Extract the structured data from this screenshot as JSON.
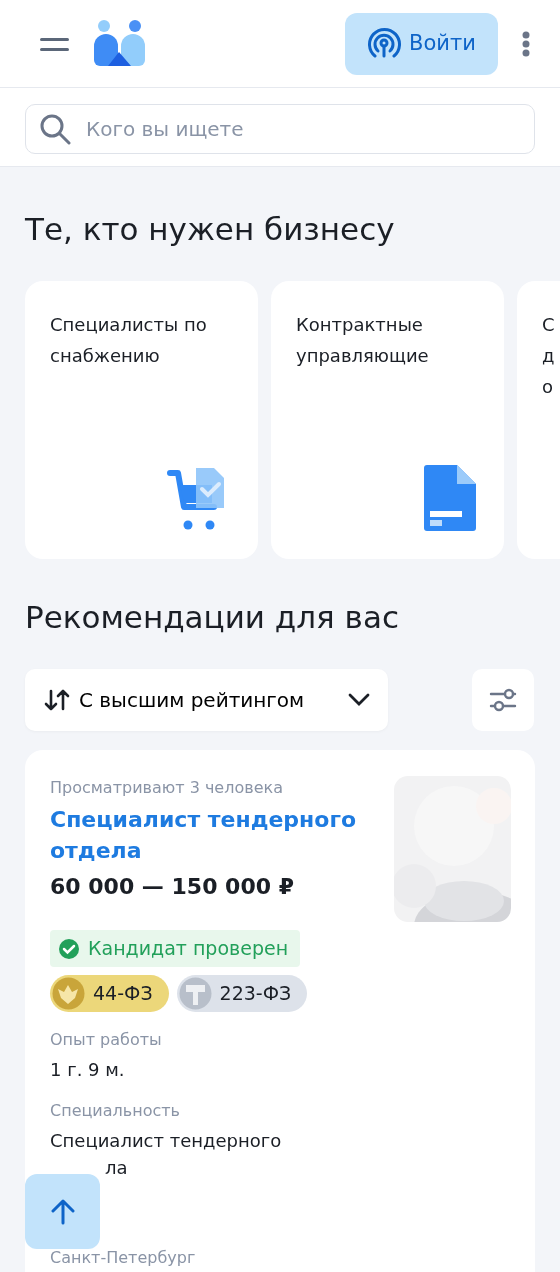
{
  "header": {
    "login_button": "Войти"
  },
  "search": {
    "placeholder": "Кого вы ищете"
  },
  "categories_title": "Те, кто нужен бизнесу",
  "categories": [
    {
      "title": "Специалисты по снабжению",
      "kind": "cart"
    },
    {
      "title": "Контрактные управляющие",
      "kind": "document"
    },
    {
      "title": "С\nд\nо",
      "kind": "none"
    }
  ],
  "recommendations_title": "Рекомендации для вас",
  "sort": {
    "label": "С высшим рейтингом"
  },
  "candidate": {
    "viewers": "Просматривают 3 человека",
    "title": "Специалист тендерного отдела",
    "salary": "60 000 — 150 000 ₽",
    "verified": true,
    "verified_label": "Кандидат проверен",
    "tags": [
      {
        "label": "44-ФЗ",
        "color": "#ecd77a",
        "kind": "eagle"
      },
      {
        "label": "223-ФЗ",
        "color": "#dde2ea",
        "kind": "hammer"
      }
    ],
    "fields": [
      {
        "label": "Опыт работы",
        "value": "1 г. 9 м."
      },
      {
        "label": "Специальность",
        "value_lines": [
          "Специалист тендерного",
          "ла"
        ]
      }
    ],
    "location": "Санкт-Петербург"
  }
}
